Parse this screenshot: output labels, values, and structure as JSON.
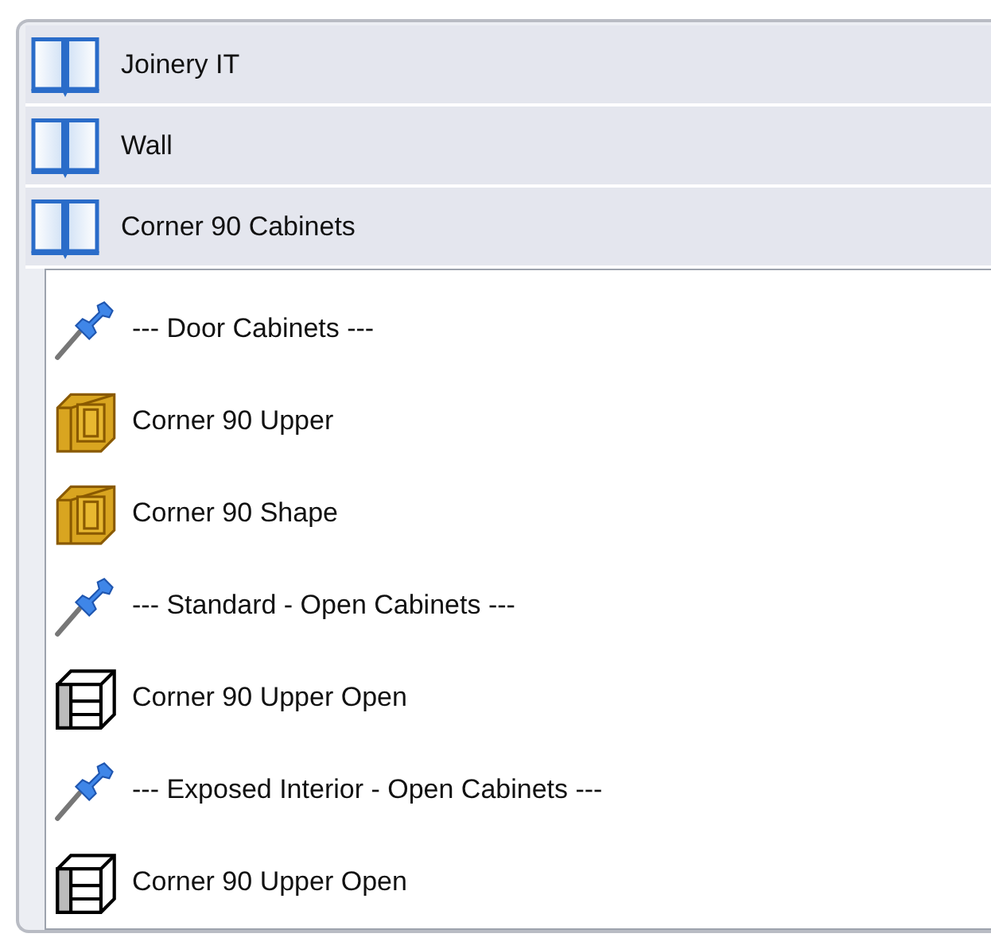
{
  "sections": [
    {
      "title": "Joinery IT",
      "expanded": false
    },
    {
      "title": "Wall",
      "expanded": false
    },
    {
      "title": "Corner 90 Cabinets",
      "expanded": true,
      "items": [
        {
          "kind": "pin",
          "label": "--- Door Cabinets ---"
        },
        {
          "kind": "door",
          "label": "Corner 90 Upper"
        },
        {
          "kind": "door",
          "label": "Corner 90 Shape"
        },
        {
          "kind": "pin",
          "label": "--- Standard - Open Cabinets ---"
        },
        {
          "kind": "open",
          "label": "Corner 90 Upper Open"
        },
        {
          "kind": "pin",
          "label": "--- Exposed Interior - Open Cabinets ---"
        },
        {
          "kind": "open",
          "label": "Corner 90 Upper Open"
        }
      ]
    }
  ]
}
